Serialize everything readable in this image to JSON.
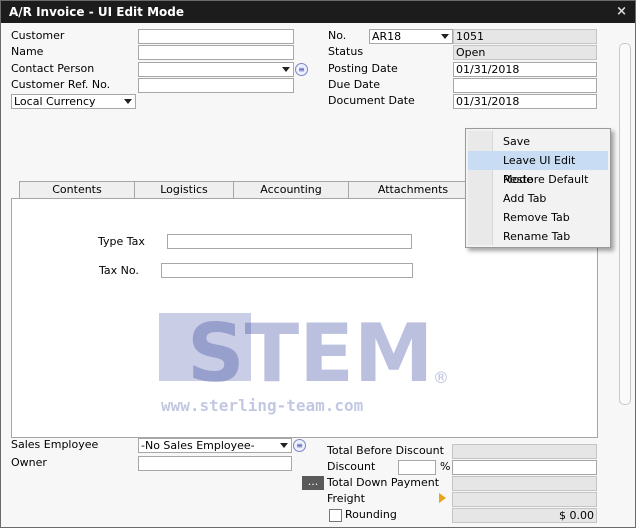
{
  "window": {
    "title": "A/R Invoice - UI Edit Mode",
    "close_glyph": "×"
  },
  "header_left": {
    "customer_label": "Customer",
    "name_label": "Name",
    "contact_label": "Contact Person",
    "customer_ref_label": "Customer Ref. No.",
    "currency_value": "Local Currency"
  },
  "header_right": {
    "no_label": "No.",
    "series_value": "AR18",
    "no_value": "1051",
    "status_label": "Status",
    "status_value": "Open",
    "posting_label": "Posting Date",
    "posting_value": "01/31/2018",
    "due_label": "Due Date",
    "document_label": "Document Date",
    "document_value": "01/31/2018"
  },
  "context_menu": {
    "items": [
      "Save",
      "Leave UI Edit Mode",
      "Restore Default",
      "Add Tab",
      "Remove Tab",
      "Rename Tab"
    ],
    "highlighted_index": 1
  },
  "tabs": [
    "Contents",
    "Logistics",
    "Accounting",
    "Attachments"
  ],
  "tab_panel": {
    "type_tax_label": "Type Tax",
    "tax_no_label": "Tax No."
  },
  "watermark": {
    "brand": "STEM",
    "url": "www.sterling-team.com",
    "registered": "®"
  },
  "footer_left": {
    "sales_employee_label": "Sales Employee",
    "sales_employee_value": "-No Sales Employee-",
    "owner_label": "Owner"
  },
  "footer_right": {
    "total_before_discount_label": "Total Before Discount",
    "discount_label": "Discount",
    "percent_sign": "%",
    "total_down_payment_label": "Total Down Payment",
    "dots_label": "...",
    "freight_label": "Freight",
    "rounding_label": "Rounding",
    "rounding_value": "$ 0.00"
  },
  "colors": {
    "titlebar": "#1c1c1c",
    "menu_highlight": "#c8dcf4",
    "watermark": "#3c4da0",
    "freight_arrow": "#e8a317"
  }
}
